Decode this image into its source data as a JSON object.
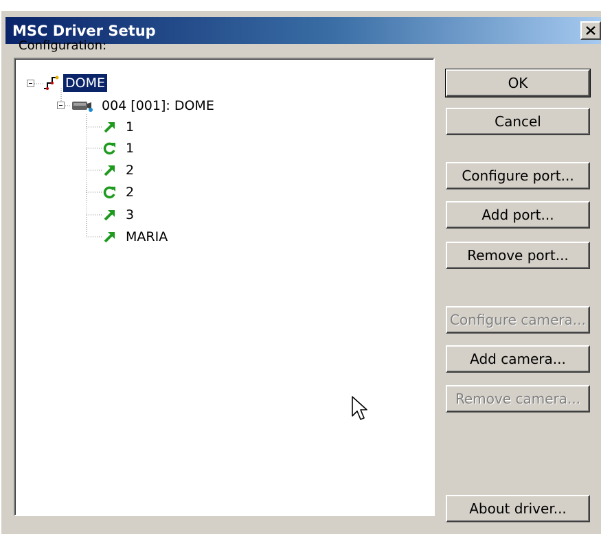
{
  "window": {
    "title": "MSC Driver Setup"
  },
  "config": {
    "label": "Configuration:"
  },
  "tree": {
    "root": "DOME",
    "camera": "004 [001]: DOME",
    "children": [
      {
        "label": "1",
        "icon": "green-arrow-icon"
      },
      {
        "label": "1",
        "icon": "green-refresh-icon"
      },
      {
        "label": "2",
        "icon": "green-arrow-icon"
      },
      {
        "label": "2",
        "icon": "green-refresh-icon"
      },
      {
        "label": "3",
        "icon": "green-arrow-icon"
      },
      {
        "label": "MARIA",
        "icon": "green-arrow-icon"
      }
    ]
  },
  "buttons": {
    "ok": "OK",
    "cancel": "Cancel",
    "configure_port": "Configure port...",
    "add_port": "Add port...",
    "remove_port": "Remove port...",
    "configure_camera": "Configure camera...",
    "add_camera": "Add camera...",
    "remove_camera": "Remove camera...",
    "about_driver": "About driver..."
  },
  "colors": {
    "title_start": "#0a246a",
    "title_end": "#a6caf0",
    "face": "#d4d0c8",
    "selection": "#0a246a",
    "icon_green": "#1e9a1e"
  }
}
